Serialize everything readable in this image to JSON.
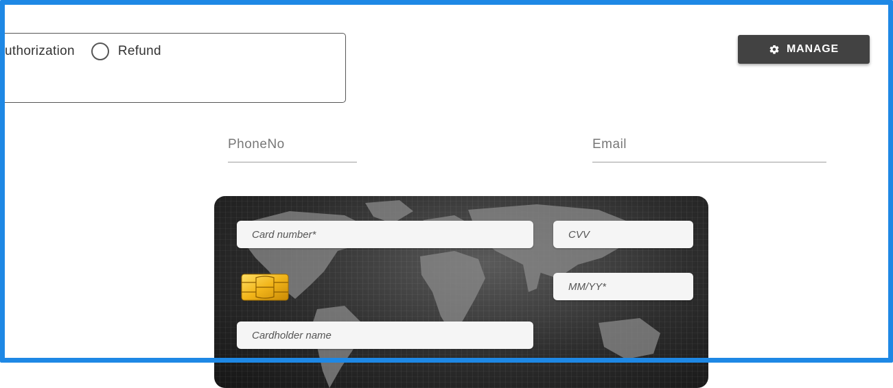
{
  "transaction_type": {
    "options": [
      {
        "label": "uthorization"
      },
      {
        "label": "Refund"
      }
    ]
  },
  "toolbar": {
    "manage_label": "MANAGE",
    "manage_icon": "gear-icon"
  },
  "contact": {
    "phone_placeholder": "PhoneNo",
    "email_placeholder": "Email"
  },
  "card": {
    "number_placeholder": "Card number*",
    "cvv_placeholder": "CVV",
    "expiry_placeholder": "MM/YY*",
    "holder_placeholder": "Cardholder name",
    "chip_icon": "card-chip-icon",
    "background": "world-map"
  },
  "colors": {
    "frame": "#1e88e5",
    "button": "#424242",
    "card": "#2c2c2c"
  }
}
